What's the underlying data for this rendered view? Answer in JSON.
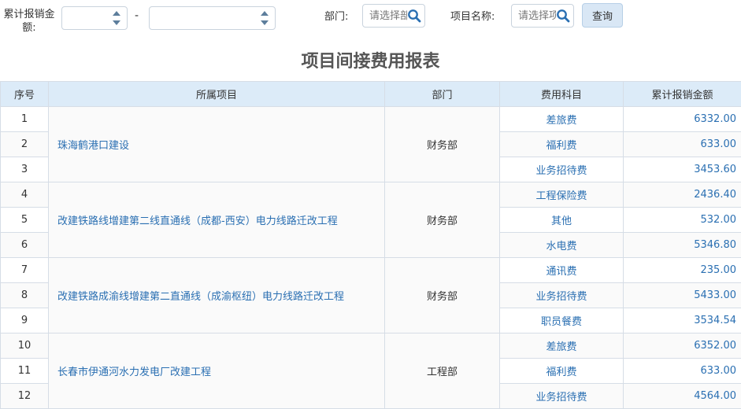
{
  "filters": {
    "amount_label": "累计报销金额:",
    "amount_min": "",
    "amount_max": "",
    "range_separator": "-",
    "dept_label": "部门:",
    "dept_placeholder": "请选择部门",
    "project_label": "项目名称:",
    "project_placeholder": "请选择项目",
    "query_label": "查询"
  },
  "report": {
    "title": "项目间接费用报表",
    "columns": [
      "序号",
      "所属项目",
      "部门",
      "费用科目",
      "累计报销金额"
    ],
    "groups": [
      {
        "project": "珠海鹤港口建设",
        "department": "财务部",
        "rows": [
          {
            "seq": "1",
            "subject": "差旅费",
            "amount": "6332.00"
          },
          {
            "seq": "2",
            "subject": "福利费",
            "amount": "633.00"
          },
          {
            "seq": "3",
            "subject": "业务招待费",
            "amount": "3453.60"
          }
        ]
      },
      {
        "project": "改建铁路线增建第二线直通线（成都-西安）电力线路迁改工程",
        "department": "财务部",
        "rows": [
          {
            "seq": "4",
            "subject": "工程保险费",
            "amount": "2436.40"
          },
          {
            "seq": "5",
            "subject": "其他",
            "amount": "532.00"
          },
          {
            "seq": "6",
            "subject": "水电费",
            "amount": "5346.80"
          }
        ]
      },
      {
        "project": "改建铁路成渝线增建第二直通线（成渝枢纽）电力线路迁改工程",
        "department": "财务部",
        "rows": [
          {
            "seq": "7",
            "subject": "通讯费",
            "amount": "235.00"
          },
          {
            "seq": "8",
            "subject": "业务招待费",
            "amount": "5433.00"
          },
          {
            "seq": "9",
            "subject": "职员餐费",
            "amount": "3534.54"
          }
        ]
      },
      {
        "project": "长春市伊通河水力发电厂改建工程",
        "department": "工程部",
        "rows": [
          {
            "seq": "10",
            "subject": "差旅费",
            "amount": "6352.00"
          },
          {
            "seq": "11",
            "subject": "福利费",
            "amount": "633.00"
          },
          {
            "seq": "12",
            "subject": "业务招待费",
            "amount": "4564.00"
          }
        ]
      }
    ]
  },
  "icons": {
    "search": "search-icon",
    "spin_up": "chevron-up-icon",
    "spin_down": "chevron-down-icon"
  },
  "colors": {
    "header_bg": "#dcebf8",
    "link": "#2a6fb2",
    "button_bg": "#d9e7f5",
    "border": "#d6dde6"
  }
}
